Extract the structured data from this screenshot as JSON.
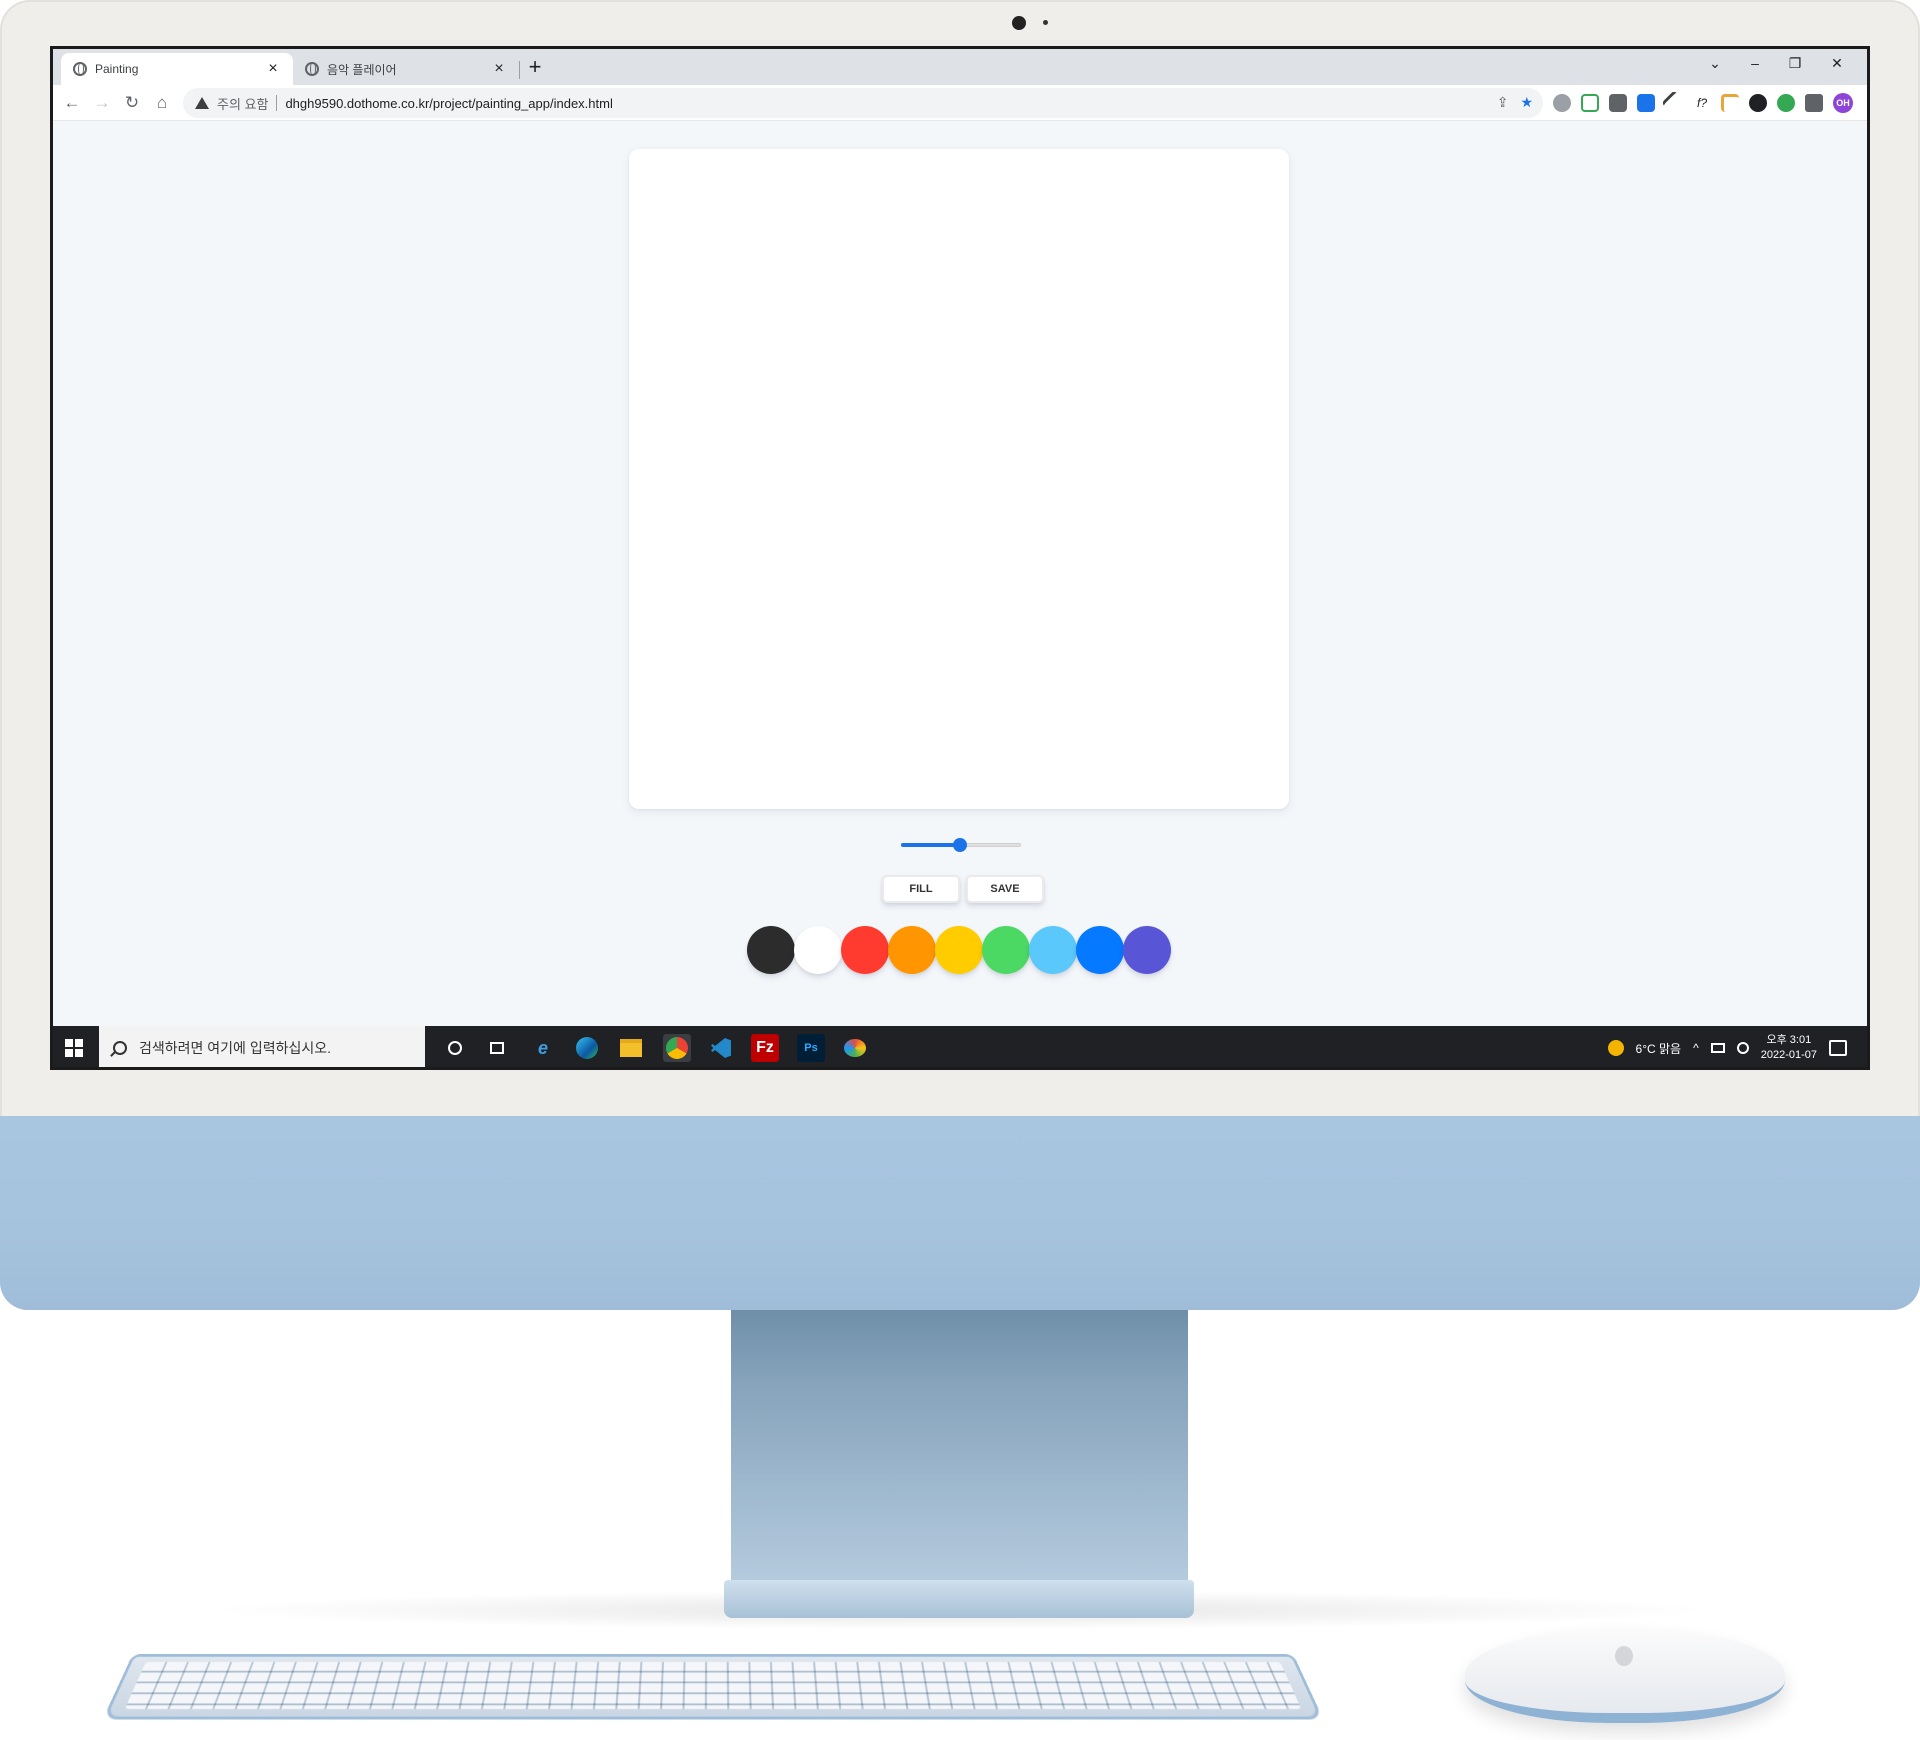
{
  "browser": {
    "tabs": [
      {
        "title": "Painting",
        "active": true
      },
      {
        "title": "음악 플레이어",
        "active": false
      }
    ],
    "close_glyph": "×",
    "new_tab_glyph": "+",
    "window_controls": {
      "dropdown": "⌄",
      "minimize": "–",
      "restore": "❐",
      "close": "✕"
    },
    "nav": {
      "back": "←",
      "forward": "→",
      "reload": "↻",
      "home": "⌂"
    },
    "address": {
      "security_label": "주의 요함",
      "url": "dhgh9590.dothome.co.kr/project/painting_app/index.html"
    },
    "omnibox_icons": {
      "share": "⇪",
      "star": "★"
    },
    "profile_initials": "OH",
    "menu_glyph": "⋮"
  },
  "app": {
    "brush_size": {
      "min": 0.1,
      "max": 5.0,
      "value": 2.5
    },
    "buttons": {
      "fill": "FILL",
      "save": "SAVE"
    },
    "colors": [
      "#2c2c2c",
      "#ffffff",
      "#ff3b30",
      "#ff9500",
      "#ffcc00",
      "#4cd963",
      "#5ac8fa",
      "#0579ff",
      "#5856d6"
    ]
  },
  "taskbar": {
    "search_placeholder": "검색하려면 여기에 입력하십시오.",
    "weather": "6°C 맑음",
    "time": "오후 3:01",
    "date": "2022-01-07",
    "apps": [
      "cortana-icon",
      "task-view-icon",
      "ie-icon",
      "edge-icon",
      "file-explorer-icon",
      "chrome-icon",
      "vscode-icon",
      "filezilla-icon",
      "photoshop-icon",
      "paint-icon"
    ]
  }
}
